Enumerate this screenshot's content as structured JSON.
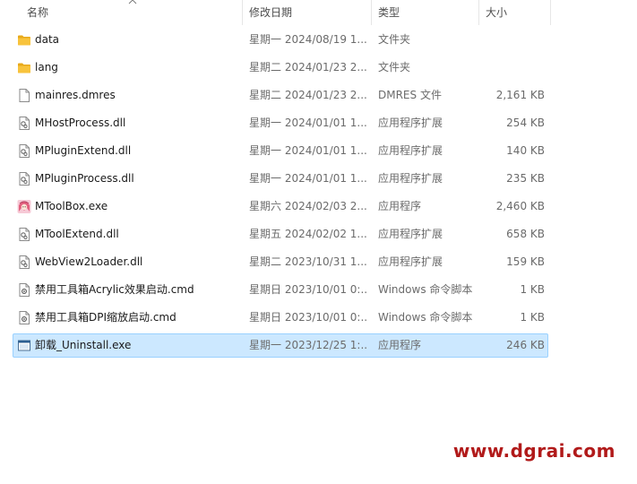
{
  "columns": {
    "name": "名称",
    "date": "修改日期",
    "type": "类型",
    "size": "大小"
  },
  "files": [
    {
      "name": "data",
      "date": "星期一 2024/08/19 1...",
      "type": "文件夹",
      "size": "",
      "icon": "folder-icon",
      "selected": false
    },
    {
      "name": "lang",
      "date": "星期二 2024/01/23 2...",
      "type": "文件夹",
      "size": "",
      "icon": "folder-icon",
      "selected": false
    },
    {
      "name": "mainres.dmres",
      "date": "星期二 2024/01/23 2...",
      "type": "DMRES 文件",
      "size": "2,161 KB",
      "icon": "file-icon",
      "selected": false
    },
    {
      "name": "MHostProcess.dll",
      "date": "星期一 2024/01/01 1...",
      "type": "应用程序扩展",
      "size": "254 KB",
      "icon": "dll-icon",
      "selected": false
    },
    {
      "name": "MPluginExtend.dll",
      "date": "星期一 2024/01/01 1...",
      "type": "应用程序扩展",
      "size": "140 KB",
      "icon": "dll-icon",
      "selected": false
    },
    {
      "name": "MPluginProcess.dll",
      "date": "星期一 2024/01/01 1...",
      "type": "应用程序扩展",
      "size": "235 KB",
      "icon": "dll-icon",
      "selected": false
    },
    {
      "name": "MToolBox.exe",
      "date": "星期六 2024/02/03 2...",
      "type": "应用程序",
      "size": "2,460 KB",
      "icon": "app-avatar-icon",
      "selected": false
    },
    {
      "name": "MToolExtend.dll",
      "date": "星期五 2024/02/02 1...",
      "type": "应用程序扩展",
      "size": "658 KB",
      "icon": "dll-icon",
      "selected": false
    },
    {
      "name": "WebView2Loader.dll",
      "date": "星期二 2023/10/31 1...",
      "type": "应用程序扩展",
      "size": "159 KB",
      "icon": "dll-icon",
      "selected": false
    },
    {
      "name": "禁用工具箱Acrylic效果启动.cmd",
      "date": "星期日 2023/10/01 0:...",
      "type": "Windows 命令脚本",
      "size": "1 KB",
      "icon": "cmd-icon",
      "selected": false
    },
    {
      "name": "禁用工具箱DPI缩放启动.cmd",
      "date": "星期日 2023/10/01 0:...",
      "type": "Windows 命令脚本",
      "size": "1 KB",
      "icon": "cmd-icon",
      "selected": false
    },
    {
      "name": "卸载_Uninstall.exe",
      "date": "星期一 2023/12/25 1:...",
      "type": "应用程序",
      "size": "246 KB",
      "icon": "exe-window-icon",
      "selected": true
    }
  ],
  "watermark": "www.dgrai.com",
  "colors": {
    "selection_bg": "#cce8ff",
    "selection_border": "#99d1ff",
    "folder": "#f8c33c",
    "watermark": "#b11a1a"
  }
}
